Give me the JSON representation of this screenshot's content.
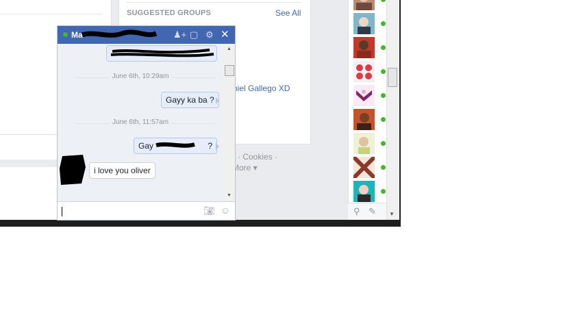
{
  "right_column": {
    "suggested_groups_title": "SUGGESTED GROUPS",
    "see_all": "See All",
    "group_member_text": "niel Gallego XD",
    "footer_cookies": "· Cookies ·",
    "footer_more": "More ▾"
  },
  "chat": {
    "contact_name": "Ma",
    "status_color": "#42b72a",
    "header_color": "#4267b2",
    "header_icons": [
      "add-friend-icon",
      "video-call-icon",
      "gear-icon",
      "close-icon"
    ],
    "date_separators": [
      "June 6th, 10:29am",
      "June 6th, 11:57am"
    ],
    "messages": [
      {
        "direction": "out",
        "text": "Gayy ka ba ?"
      },
      {
        "direction": "out",
        "text": "Gay",
        "suffix": "?"
      },
      {
        "direction": "in",
        "text": "i love you oliver"
      }
    ],
    "input_icons": [
      "camera-icon",
      "emoji-icon"
    ]
  },
  "sidebar": {
    "online_color": "#42b72a",
    "tools": [
      "search-icon",
      "compose-icon"
    ]
  }
}
